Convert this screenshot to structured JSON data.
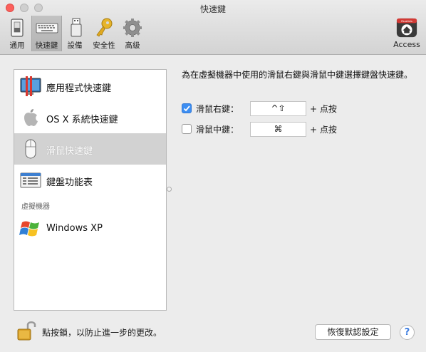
{
  "window": {
    "title": "快速鍵"
  },
  "toolbar": {
    "items": [
      {
        "label": "通用",
        "icon": "general-switch-icon"
      },
      {
        "label": "快速鍵",
        "icon": "keyboard-icon",
        "selected": true
      },
      {
        "label": "設備",
        "icon": "usb-device-icon"
      },
      {
        "label": "安全性",
        "icon": "key-icon"
      },
      {
        "label": "高級",
        "icon": "gear-icon"
      }
    ],
    "access": {
      "label": "Access",
      "icon": "parallels-access-icon",
      "badge": "Parallels"
    }
  },
  "sidebar": {
    "items": [
      {
        "label": "應用程式快速鍵",
        "icon": "parallels-app-icon"
      },
      {
        "label": "OS X 系統快速鍵",
        "icon": "apple-logo-icon"
      },
      {
        "label": "滑鼠快速鍵",
        "icon": "mouse-icon",
        "selected": true
      },
      {
        "label": "鍵盤功能表",
        "icon": "keyboard-menu-icon"
      }
    ],
    "section_label": "虛擬機器",
    "vm_items": [
      {
        "label": "Windows XP",
        "icon": "windows-logo-icon"
      }
    ]
  },
  "content": {
    "description": "為在虛擬機器中使用的滑鼠右鍵與滑鼠中鍵選擇鍵盤快速鍵。",
    "rows": [
      {
        "label": "滑鼠右鍵：",
        "checked": true,
        "shortcut": "^⇧",
        "suffix": "+ 点按"
      },
      {
        "label": "滑鼠中鍵：",
        "checked": false,
        "shortcut": "⌘",
        "suffix": "+ 点按"
      }
    ]
  },
  "footer": {
    "lock_text": "點按鎖，以防止進一步的更改。",
    "reset_label": "恢復默認設定",
    "help_label": "?"
  },
  "colors": {
    "accent": "#3d8ef2",
    "close": "#fc605c",
    "selection": "#d2d2d2"
  }
}
